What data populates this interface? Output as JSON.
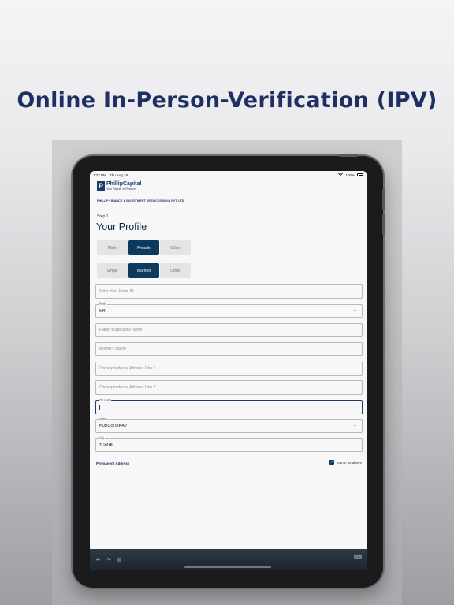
{
  "headline": "Online In-Person-Verification (IPV)",
  "status": {
    "time": "1:27 PM",
    "date": "Thu Aug 19",
    "battery": "100%"
  },
  "brand": {
    "name": "PhillipCapital",
    "tagline": "Your Partner In Finance",
    "logo_letter": "P",
    "company": "PHILLIP FINANCE & INVESTMENT SERVICES INDIA PVT. LTD"
  },
  "form": {
    "step": "Step 1",
    "title": "Your Profile",
    "gender": {
      "options": [
        "Male",
        "Female",
        "Other"
      ],
      "selected": "Female"
    },
    "marital": {
      "options": [
        "Single",
        "Married",
        "Other"
      ],
      "selected": "Married"
    },
    "email": {
      "placeholder": "Enter Your Email ID",
      "value": ""
    },
    "prefix": {
      "label": "Prefix",
      "value": "MR"
    },
    "father": {
      "placeholder": "Father's/Spouse's Name",
      "value": ""
    },
    "mother": {
      "placeholder": "Mother's Name",
      "value": ""
    },
    "addr1": {
      "placeholder": "Correspondence Address Line 1",
      "value": ""
    },
    "addr2": {
      "placeholder": "Correspondence Address Line 2",
      "value": ""
    },
    "pin": {
      "label": "Pin Code",
      "value": ""
    },
    "state": {
      "label": "State",
      "value": "PUDUCHERRY"
    },
    "city": {
      "label": "City",
      "value": "THANE"
    },
    "permanent_label": "Permanent Address",
    "same_as_above": {
      "label": "Same as above",
      "checked": true
    }
  },
  "colors": {
    "headline": "#1f2f63",
    "brand": "#1f3b6e",
    "active_segment": "#0d3a5c"
  }
}
